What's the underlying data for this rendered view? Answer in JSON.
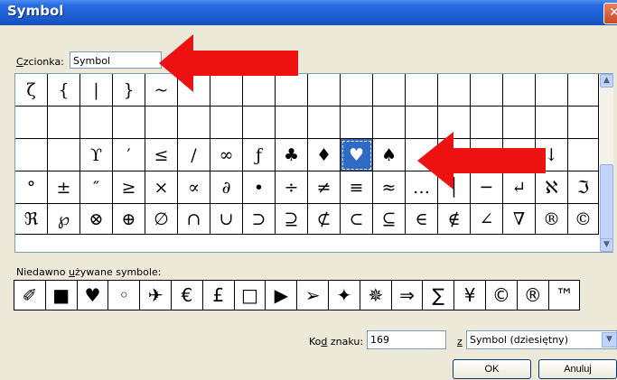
{
  "dialog": {
    "title": "Symbol",
    "close_glyph": "✕"
  },
  "font": {
    "label_prefix": "C",
    "label_rest": "zcionka:",
    "value": "Symbol"
  },
  "grid": {
    "rows": [
      [
        "ζ",
        "{",
        "|",
        "}",
        "~",
        "",
        "",
        "",
        "",
        "",
        "",
        "",
        "",
        "",
        "",
        "",
        ""
      ],
      [
        "",
        "",
        "",
        "",
        "",
        "",
        "",
        "",
        "",
        "",
        "",
        "",
        "",
        "",
        "",
        "",
        ""
      ],
      [
        "",
        "",
        "ϒ",
        "′",
        "≤",
        "/",
        "∞",
        "ƒ",
        "♣",
        "♦",
        "♥",
        "♠",
        "",
        "",
        "",
        "→",
        "↓"
      ],
      [
        "°",
        "±",
        "″",
        "≥",
        "×",
        "∝",
        "∂",
        "•",
        "÷",
        "≠",
        "≡",
        "≈",
        "…",
        "│",
        "─",
        "↵",
        "ℵ",
        "ℑ"
      ],
      [
        "ℜ",
        "℘",
        "⊗",
        "⊕",
        "∅",
        "∩",
        "∪",
        "⊃",
        "⊇",
        "⊄",
        "⊂",
        "⊆",
        "∈",
        "∉",
        "∠",
        "∇",
        "®",
        "©"
      ]
    ],
    "selected": {
      "row": 2,
      "col": 10
    }
  },
  "recent": {
    "label_pre": "Niedawno ",
    "label_u": "u",
    "label_post": "żywane symbole:",
    "items": [
      "✐",
      "■",
      "♥",
      "◦",
      "✈",
      "€",
      "£",
      "□",
      "▶",
      "➢",
      "✦",
      "✵",
      "⇒",
      "∑",
      "¥",
      "©",
      "®",
      "™"
    ]
  },
  "code": {
    "label_pre": "Ko",
    "label_u": "d",
    "label_post": " znaku:",
    "value": "169"
  },
  "from": {
    "label_u": "z",
    "value": "Symbol (dziesiętny)"
  },
  "buttons": {
    "ok": "OK",
    "cancel": "Anuluj"
  },
  "colors": {
    "arrow": "#ee1111",
    "selection": "#316ac5",
    "titlebar": "#1d5fd6"
  }
}
